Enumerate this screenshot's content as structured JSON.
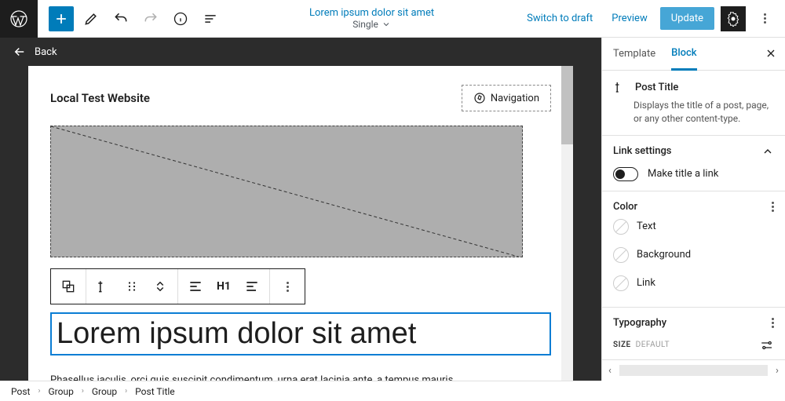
{
  "topbar": {
    "doc_title": "Lorem ipsum dolor sit amet",
    "doc_subtitle": "Single",
    "switch_draft": "Switch to draft",
    "preview": "Preview",
    "update": "Update"
  },
  "back_label": "Back",
  "canvas": {
    "site_title": "Local Test Website",
    "navigation": "Navigation",
    "post_title": "Lorem ipsum dolor sit amet",
    "body_text": "Phasellus iaculis, orci quis suscipit condimentum, urna erat lacinia ante, a tempus mauris",
    "h1_label": "H1"
  },
  "sidebar": {
    "tabs": {
      "template": "Template",
      "block": "Block"
    },
    "block_name": "Post Title",
    "block_desc": "Displays the title of a post, page, or any other content-type.",
    "link_settings": {
      "heading": "Link settings",
      "toggle_label": "Make title a link"
    },
    "color": {
      "heading": "Color",
      "items": [
        "Text",
        "Background",
        "Link"
      ]
    },
    "typography": {
      "heading": "Typography",
      "size_label": "SIZE",
      "size_default": "DEFAULT"
    }
  },
  "breadcrumb": [
    "Post",
    "Group",
    "Group",
    "Post Title"
  ]
}
